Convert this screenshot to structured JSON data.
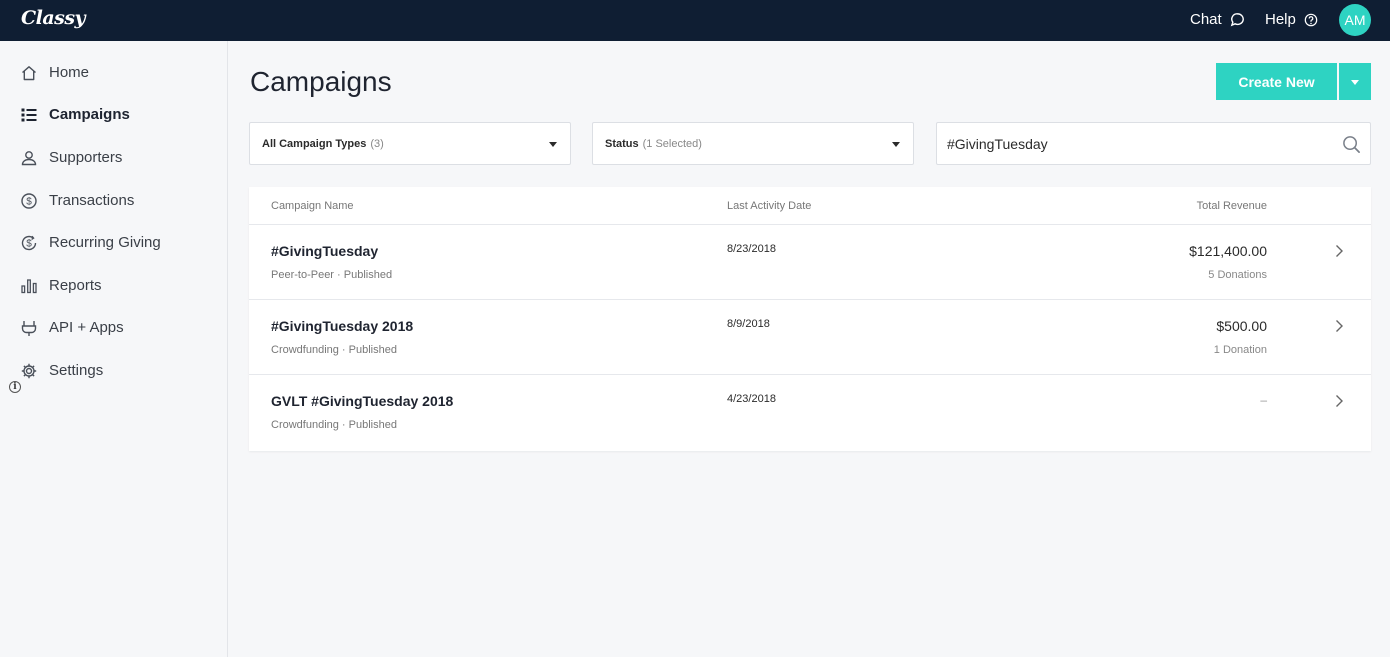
{
  "app": {
    "logo": "Classy"
  },
  "topbar": {
    "chat_label": "Chat",
    "help_label": "Help",
    "avatar_initials": "AM"
  },
  "sidebar": {
    "items": [
      {
        "label": "Home",
        "icon": "home-icon"
      },
      {
        "label": "Campaigns",
        "icon": "list-icon",
        "active": true
      },
      {
        "label": "Supporters",
        "icon": "users-icon"
      },
      {
        "label": "Transactions",
        "icon": "dollar-circle-icon"
      },
      {
        "label": "Recurring Giving",
        "icon": "recurring-dollar-icon"
      },
      {
        "label": "Reports",
        "icon": "bar-chart-icon"
      },
      {
        "label": "API + Apps",
        "icon": "plug-icon"
      },
      {
        "label": "Settings",
        "icon": "gear-icon"
      }
    ],
    "info_glyph": "i"
  },
  "main": {
    "title": "Campaigns",
    "create_button": "Create New",
    "filters": {
      "types_label": "All Campaign Types",
      "types_count": "(3)",
      "status_label": "Status",
      "status_count": "(1 Selected)"
    },
    "search": {
      "value": "#GivingTuesday",
      "placeholder": ""
    },
    "table": {
      "columns": {
        "name": "Campaign Name",
        "date": "Last Activity Date",
        "revenue": "Total Revenue"
      },
      "rows": [
        {
          "name": "#GivingTuesday",
          "sub": "Peer-to-Peer · Published",
          "date": "8/23/2018",
          "amount": "$121,400.00",
          "donations": "5 Donations"
        },
        {
          "name": "#GivingTuesday 2018",
          "sub": "Crowdfunding · Published",
          "date": "8/9/2018",
          "amount": "$500.00",
          "donations": "1 Donation"
        },
        {
          "name": "GVLT #GivingTuesday 2018",
          "sub": "Crowdfunding · Published",
          "date": "4/23/2018",
          "amount": "–",
          "donations": ""
        }
      ]
    }
  },
  "colors": {
    "topbar": "#0f1e33",
    "accent": "#2ed3c2",
    "background": "#f6f7f9"
  }
}
